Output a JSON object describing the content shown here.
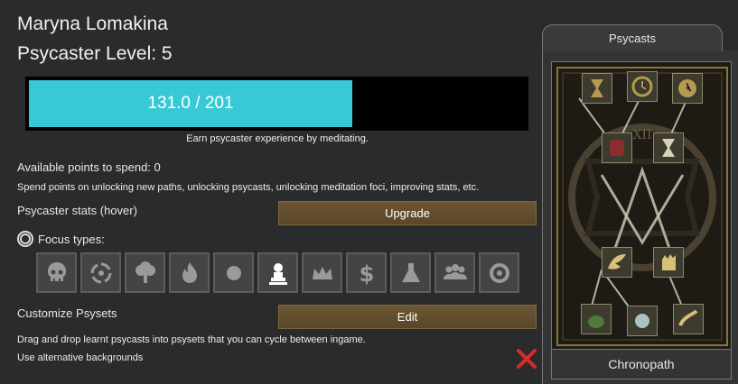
{
  "pawn": {
    "name": "Maryna Lomakina",
    "level_text": "Psycaster Level: 5"
  },
  "xp": {
    "text": "131.0 / 201",
    "fraction": 0.6517,
    "hint": "Earn psycaster experience by meditating."
  },
  "points": {
    "available": "Available points to spend: 0",
    "description": "Spend points on unlocking new paths, unlocking psycasts, unlocking meditation foci, improving stats, etc."
  },
  "stats": {
    "label": "Psycaster stats (hover)",
    "upgrade_label": "Upgrade"
  },
  "focus": {
    "label": "Focus types:",
    "types": [
      {
        "icon": "skull-icon",
        "selected": false
      },
      {
        "icon": "vortex-icon",
        "selected": false
      },
      {
        "icon": "tree-icon",
        "selected": false
      },
      {
        "icon": "flame-icon",
        "selected": false
      },
      {
        "icon": "orb-icon",
        "selected": false
      },
      {
        "icon": "bust-icon",
        "selected": true
      },
      {
        "icon": "crown-icon",
        "selected": false
      },
      {
        "icon": "dollar-icon",
        "selected": false
      },
      {
        "icon": "flask-icon",
        "selected": false
      },
      {
        "icon": "people-icon",
        "selected": false
      },
      {
        "icon": "ring-icon",
        "selected": false
      }
    ]
  },
  "psysets": {
    "label": "Customize Psysets",
    "edit_label": "Edit",
    "description": "Drag and drop learnt psycasts into psysets that you can cycle between ingame.",
    "alt_backgrounds": "Use alternative backgrounds"
  },
  "panel": {
    "title": "Psycasts",
    "path_name": "Chronopath"
  },
  "colors": {
    "xp_fill": "#38c9d6",
    "button": "#6c5633",
    "close": "#d92b2b",
    "tree_gold": "#b59a4f"
  }
}
